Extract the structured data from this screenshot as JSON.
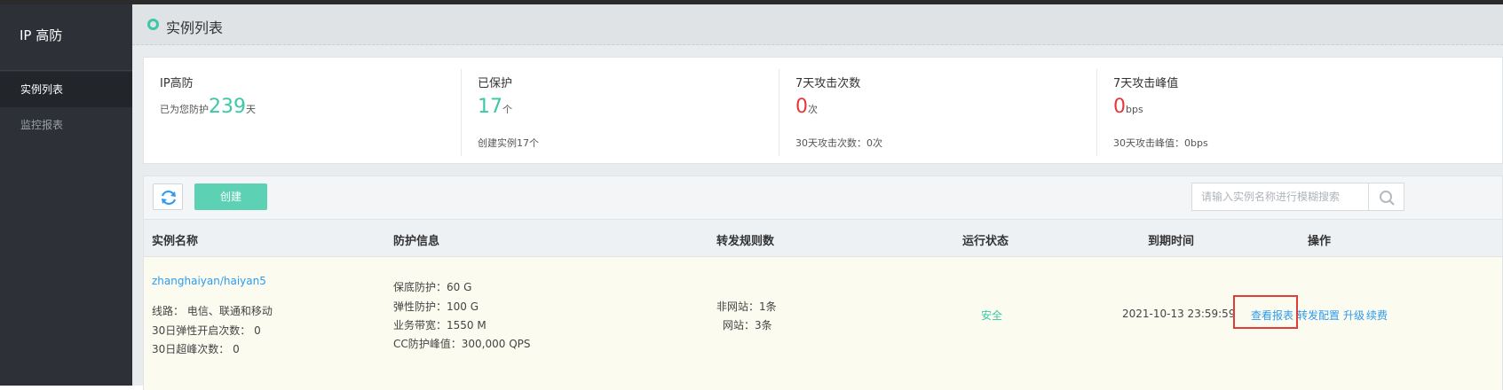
{
  "sidebar": {
    "title": "IP 高防",
    "items": [
      {
        "label": "实例列表"
      },
      {
        "label": "监控报表"
      }
    ]
  },
  "header": {
    "title": "实例列表"
  },
  "stats": [
    {
      "label": "IP高防",
      "prefix": "已为您防护",
      "value": "239",
      "unit": "天",
      "sub": ""
    },
    {
      "label": "已保护",
      "prefix": "",
      "value": "17",
      "unit": "个",
      "sub": "创建实例17个"
    },
    {
      "label": "7天攻击次数",
      "prefix": "",
      "value": "0",
      "unit": "次",
      "sub": "30天攻击次数：0次"
    },
    {
      "label": "7天攻击峰值",
      "prefix": "",
      "value": "0",
      "unit": "bps",
      "sub": "30天攻击峰值：0bps"
    }
  ],
  "toolbar": {
    "refresh_icon": "refresh-icon",
    "create_label": "创建",
    "search_placeholder": "请输入实例名称进行模糊搜索",
    "search_icon": "search-icon"
  },
  "table": {
    "headers": [
      "实例名称",
      "防护信息",
      "转发规则数",
      "运行状态",
      "到期时间",
      "操作"
    ],
    "rows": [
      {
        "name": "zhanghaiyan/haiyan5",
        "line": "线路： 电信、联通和移动",
        "elastic_count": "30日弹性开启次数： 0",
        "exceed_count": "30日超峰次数： 0",
        "protection": [
          "保底防护：60 G",
          "弹性防护：100 G",
          "业务带宽：1550 M",
          "CC防护峰值：300,000 QPS"
        ],
        "rules": [
          "非网站：1条",
          "网站：3条"
        ],
        "status": "安全",
        "expire": "2021-10-13 23:59:59",
        "actions": [
          "查看报表",
          "转发配置",
          "升级",
          "续费"
        ]
      }
    ]
  },
  "colors": {
    "accent": "#3cc8a6",
    "link": "#2d9bf0",
    "danger": "#e4393c",
    "sidebar": "#2d3036"
  }
}
